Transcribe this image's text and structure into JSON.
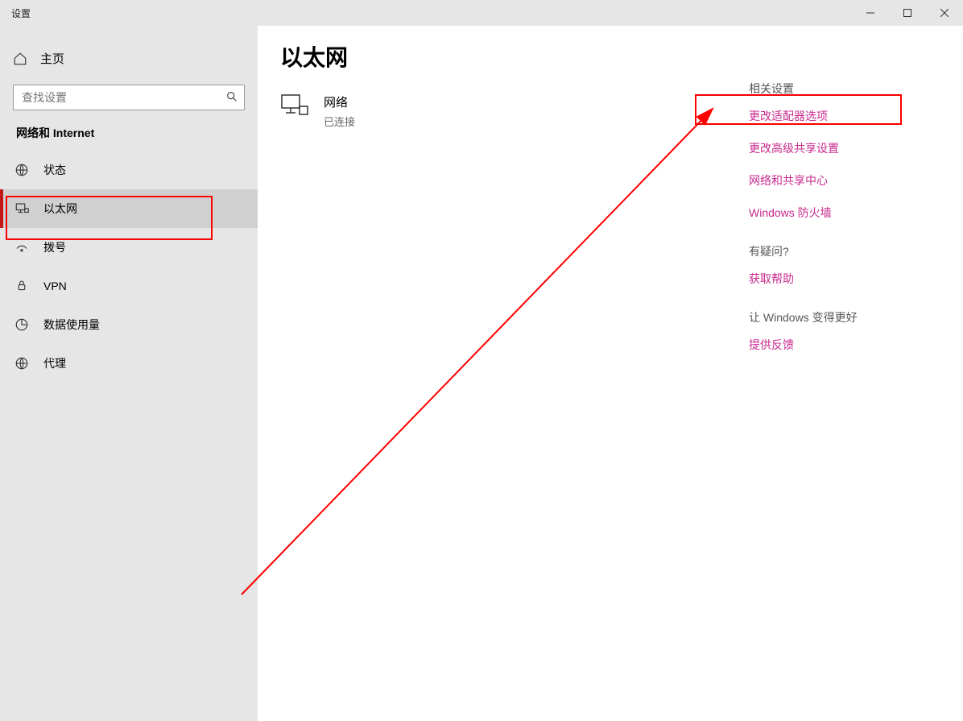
{
  "window": {
    "title": "设置"
  },
  "sidebar": {
    "home": "主页",
    "search_placeholder": "查找设置",
    "section": "网络和 Internet",
    "items": [
      {
        "label": "状态"
      },
      {
        "label": "以太网"
      },
      {
        "label": "拨号"
      },
      {
        "label": "VPN"
      },
      {
        "label": "数据使用量"
      },
      {
        "label": "代理"
      }
    ]
  },
  "page": {
    "title": "以太网",
    "network": {
      "name": "网络",
      "status": "已连接"
    }
  },
  "related": {
    "heading1": "相关设置",
    "links1": [
      "更改适配器选项",
      "更改高级共享设置",
      "网络和共享中心",
      "Windows 防火墙"
    ],
    "heading2": "有疑问?",
    "links2": [
      "获取帮助"
    ],
    "heading3": "让 Windows 变得更好",
    "links3": [
      "提供反馈"
    ]
  }
}
